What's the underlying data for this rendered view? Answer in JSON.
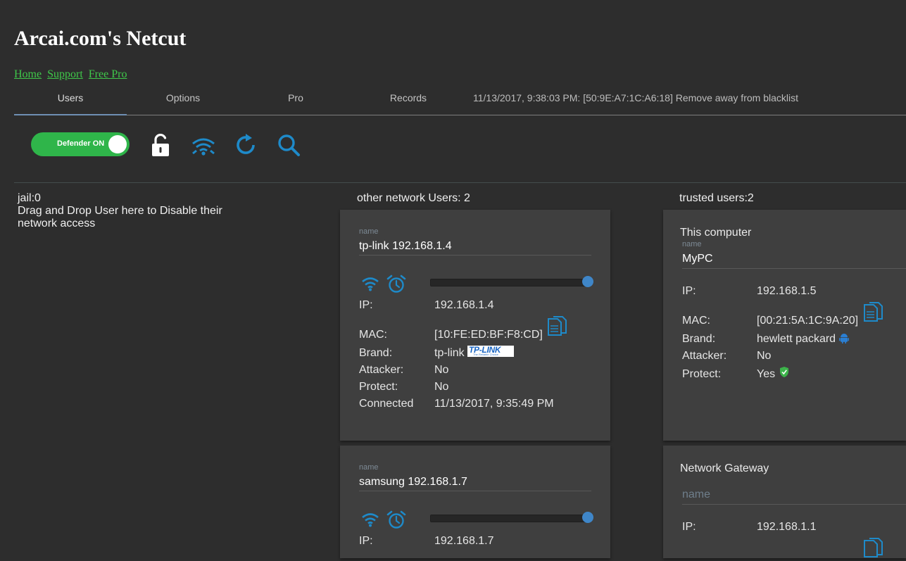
{
  "app": {
    "title": "Arcai.com's Netcut",
    "links": [
      "Home",
      "Support",
      "Free Pro"
    ]
  },
  "tabs": [
    "Users",
    "Options",
    "Pro",
    "Records"
  ],
  "active_tab": "Users",
  "status_message": "11/13/2017, 9:38:03 PM: [50:9E:A7:1C:A6:18] Remove away from blacklist",
  "toolbar": {
    "defender_label": "Defender ON",
    "defender_on": true,
    "icons": [
      "unlock-icon",
      "wifi-icon",
      "refresh-icon",
      "search-icon"
    ]
  },
  "jail": {
    "count_label": "jail:0",
    "hint": "Drag and Drop User here to Disable their network access"
  },
  "other_users": {
    "heading": "other network Users: 2",
    "cards": [
      {
        "name_label": "name",
        "name": "tp-link 192.168.1.4",
        "slider_level": 1.0,
        "rows": {
          "ip_label": "IP:",
          "ip": "192.168.1.4",
          "mac_label": "MAC:",
          "mac": "[10:FE:ED:BF:F8:CD]",
          "brand_label": "Brand:",
          "brand": "tp-link",
          "brand_logo_text": "TP-LINK",
          "brand_logo_tagline": "The Reliable Choice",
          "attacker_label": "Attacker:",
          "attacker": "No",
          "protect_label": "Protect:",
          "protect": "No",
          "connected_label": "Connected",
          "connected": "11/13/2017, 9:35:49 PM"
        }
      },
      {
        "name_label": "name",
        "name": "samsung 192.168.1.7",
        "slider_level": 1.0,
        "rows": {
          "ip_label": "IP:",
          "ip": "192.168.1.7"
        }
      }
    ]
  },
  "trusted_users": {
    "heading": "trusted users:2",
    "cards": [
      {
        "title": "This computer",
        "name_label": "name",
        "name": "MyPC",
        "rows": {
          "ip_label": "IP:",
          "ip": "192.168.1.5",
          "mac_label": "MAC:",
          "mac": "[00:21:5A:1C:9A:20]",
          "brand_label": "Brand:",
          "brand": "hewlett packard",
          "attacker_label": "Attacker:",
          "attacker": "No",
          "protect_label": "Protect:",
          "protect": "Yes"
        }
      },
      {
        "title": "Network Gateway",
        "name_placeholder": "name",
        "rows": {
          "ip_label": "IP:",
          "ip": "192.168.1.1"
        }
      }
    ]
  },
  "colors": {
    "background": "#2d2d2d",
    "card": "#3f3f3f",
    "accent_blue": "#1e8ac9",
    "toggle_green": "#2fb54a",
    "link_green": "#3fc84a"
  }
}
